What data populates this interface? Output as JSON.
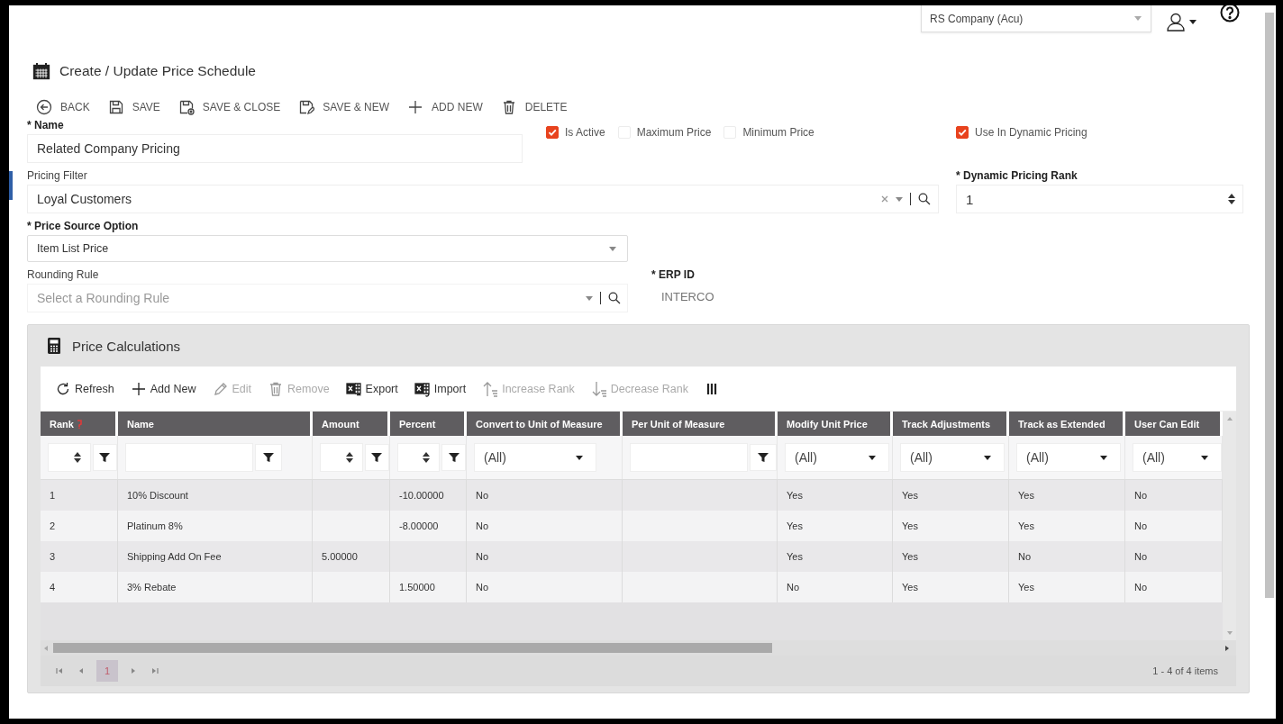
{
  "header": {
    "company_select": "RS Company (Acu)"
  },
  "page_title": "Create / Update Price Schedule",
  "toolbar": [
    {
      "label": "BACK",
      "kind": "back"
    },
    {
      "label": "SAVE",
      "kind": "save"
    },
    {
      "label": "SAVE & CLOSE",
      "kind": "save-close"
    },
    {
      "label": "SAVE & NEW",
      "kind": "save-new"
    },
    {
      "label": "ADD NEW",
      "kind": "add"
    },
    {
      "label": "DELETE",
      "kind": "delete"
    }
  ],
  "form": {
    "name": {
      "label": "* Name",
      "value": "Related Company Pricing"
    },
    "checkboxes": [
      {
        "label": "Is Active",
        "checked": true
      },
      {
        "label": "Maximum Price",
        "checked": false
      },
      {
        "label": "Minimum Price",
        "checked": false
      }
    ],
    "dynamic_checkbox": {
      "label": "Use In Dynamic Pricing",
      "checked": true
    },
    "pricing_filter": {
      "label": "Pricing Filter",
      "value": "Loyal Customers"
    },
    "dynamic_rank": {
      "label": "* Dynamic Pricing Rank",
      "value": "1"
    },
    "price_source": {
      "label": "* Price Source Option",
      "value": "Item List Price"
    },
    "rounding_rule": {
      "label": "Rounding Rule",
      "placeholder": "Select a Rounding Rule"
    },
    "erp_id": {
      "label": "* ERP ID",
      "value": "INTERCO"
    }
  },
  "price_calculations": {
    "title": "Price Calculations",
    "toolbar": [
      {
        "label": "Refresh",
        "kind": "refresh",
        "disabled": false
      },
      {
        "label": "Add New",
        "kind": "add",
        "disabled": false
      },
      {
        "label": "Edit",
        "kind": "edit",
        "disabled": true
      },
      {
        "label": "Remove",
        "kind": "remove",
        "disabled": true
      },
      {
        "label": "Export",
        "kind": "export",
        "disabled": false
      },
      {
        "label": "Import",
        "kind": "import",
        "disabled": false
      },
      {
        "label": "Increase Rank",
        "kind": "increase-rank",
        "disabled": true
      },
      {
        "label": "Decrease Rank",
        "kind": "decrease-rank",
        "disabled": true
      },
      {
        "kind": "columns",
        "disabled": false
      }
    ],
    "columns": [
      {
        "label": "Rank",
        "kind": "numeric",
        "required": true
      },
      {
        "label": "Name",
        "kind": "text",
        "required": false
      },
      {
        "label": "Amount",
        "kind": "numeric",
        "required": false
      },
      {
        "label": "Percent",
        "kind": "numeric",
        "required": false
      },
      {
        "label": "Convert to Unit of Measure",
        "kind": "select",
        "filter_value": "(All)",
        "required": false
      },
      {
        "label": "Per Unit of Measure",
        "kind": "text",
        "required": false
      },
      {
        "label": "Modify Unit Price",
        "kind": "select",
        "filter_value": "(All)",
        "required": false
      },
      {
        "label": "Track Adjustments",
        "kind": "select",
        "filter_value": "(All)",
        "required": false
      },
      {
        "label": "Track as Extended",
        "kind": "select",
        "filter_value": "(All)",
        "required": false
      },
      {
        "label": "User Can Edit",
        "kind": "select",
        "filter_value": "(All)",
        "required": false
      }
    ],
    "rows": [
      [
        "1",
        "10% Discount",
        null,
        "-10.00000",
        "No",
        null,
        "Yes",
        "Yes",
        "Yes",
        "No"
      ],
      [
        "2",
        "Platinum 8%",
        null,
        "-8.00000",
        "No",
        null,
        "Yes",
        "Yes",
        "Yes",
        "No"
      ],
      [
        "3",
        "Shipping Add On Fee",
        "5.00000",
        null,
        "No",
        null,
        "Yes",
        "Yes",
        "No",
        "No"
      ],
      [
        "4",
        "3% Rebate",
        null,
        "1.50000",
        "No",
        null,
        "No",
        "Yes",
        "Yes",
        "No"
      ]
    ],
    "pager": {
      "pages": [
        {
          "label": "1",
          "selected": true
        }
      ],
      "summary": "1 - 4 of 4 items"
    }
  }
}
